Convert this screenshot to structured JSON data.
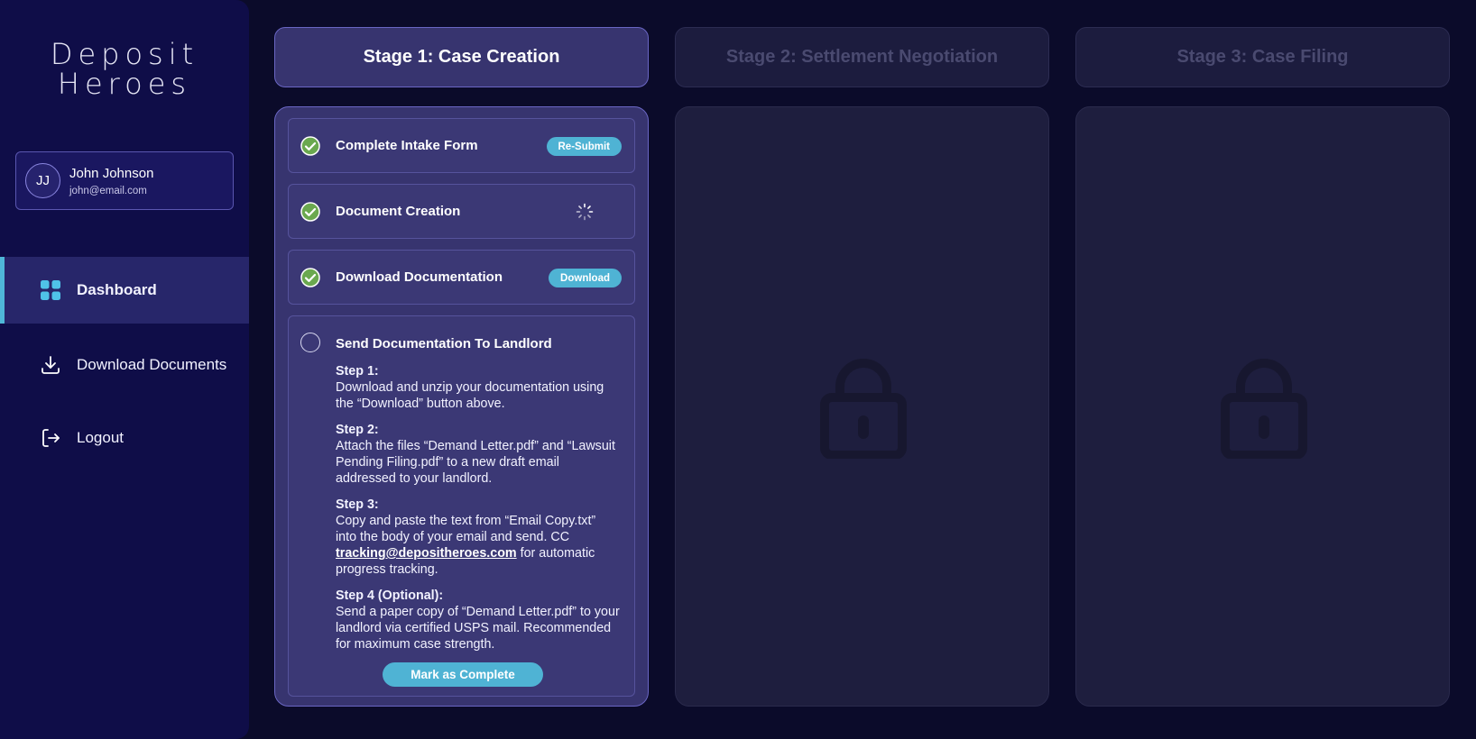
{
  "app": {
    "logo_line1": "Deposit",
    "logo_line2": "Heroes"
  },
  "user": {
    "initials": "JJ",
    "name": "John Johnson",
    "email": "john@email.com"
  },
  "nav": {
    "items": [
      {
        "label": "Dashboard",
        "icon": "grid-icon",
        "active": true
      },
      {
        "label": "Download Documents",
        "icon": "download-icon",
        "active": false
      },
      {
        "label": "Logout",
        "icon": "logout-icon",
        "active": false
      }
    ]
  },
  "stages": [
    {
      "title": "Stage 1: Case Creation",
      "state": "active"
    },
    {
      "title": "Stage 2: Settlement Negotiation",
      "state": "locked"
    },
    {
      "title": "Stage 3: Case Filing",
      "state": "locked"
    }
  ],
  "tasks": [
    {
      "title": "Complete Intake Form",
      "status": "complete",
      "action": "Re-Submit"
    },
    {
      "title": "Document Creation",
      "status": "complete",
      "action_state": "loading"
    },
    {
      "title": "Download Documentation",
      "status": "complete",
      "action": "Download"
    },
    {
      "title": "Send Documentation To Landlord",
      "status": "pending",
      "steps": [
        {
          "title": "Step 1:",
          "text": "Download and unzip your documentation using the “Download” button above."
        },
        {
          "title": "Step 2:",
          "text": "Attach the files “Demand Letter.pdf” and “Lawsuit Pending Filing.pdf” to a new draft email addressed to your landlord."
        },
        {
          "title": "Step 3:",
          "text_before": "Copy and paste the text from “Email Copy.txt” into the body of your email and send. CC ",
          "link": "tracking@depositheroes.com",
          "text_after": " for automatic progress tracking."
        },
        {
          "title": "Step 4 (Optional):",
          "text": "Send a paper copy of “Demand Letter.pdf” to your landlord via certified USPS mail. Recommended for maximum case strength."
        }
      ],
      "action": "Mark as Complete"
    }
  ],
  "colors": {
    "background": "#0b0b2a",
    "sidebar": "#0f0d48",
    "accent": "#4fb3d4",
    "check_green": "#6aa84f",
    "active_panel": "#37346f",
    "locked_panel": "#1e1e3e"
  }
}
